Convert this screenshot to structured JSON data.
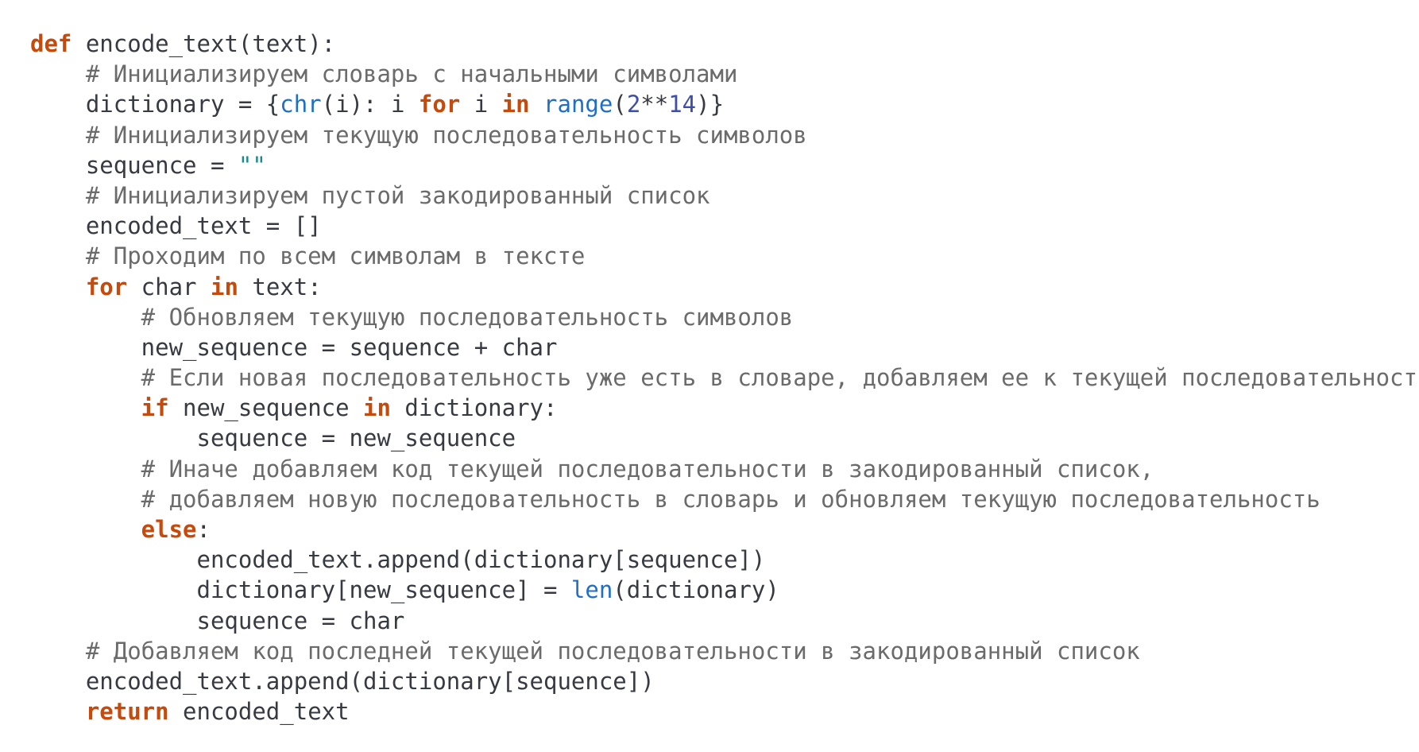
{
  "code": {
    "language": "python",
    "colors": {
      "keyword": "#c54a0b",
      "comment": "#6b6b6b",
      "builtin": "#1f6fc5",
      "number": "#3f4fa8",
      "string": "#1b8a8e",
      "text": "#383a42"
    },
    "lines": [
      {
        "indent": 0,
        "tokens": [
          {
            "t": "kw",
            "v": "def"
          },
          {
            "t": "plain",
            "v": " encode_text(text):"
          }
        ]
      },
      {
        "indent": 1,
        "tokens": [
          {
            "t": "cm",
            "v": "# Инициализируем словарь с начальными символами"
          }
        ]
      },
      {
        "indent": 1,
        "tokens": [
          {
            "t": "plain",
            "v": "dictionary = {"
          },
          {
            "t": "bi",
            "v": "chr"
          },
          {
            "t": "plain",
            "v": "(i): i "
          },
          {
            "t": "kw",
            "v": "for"
          },
          {
            "t": "plain",
            "v": " i "
          },
          {
            "t": "kw",
            "v": "in"
          },
          {
            "t": "plain",
            "v": " "
          },
          {
            "t": "bi",
            "v": "range"
          },
          {
            "t": "plain",
            "v": "("
          },
          {
            "t": "num",
            "v": "2"
          },
          {
            "t": "plain",
            "v": "**"
          },
          {
            "t": "num",
            "v": "14"
          },
          {
            "t": "plain",
            "v": ")}"
          }
        ]
      },
      {
        "indent": 1,
        "tokens": [
          {
            "t": "cm",
            "v": "# Инициализируем текущую последовательность символов"
          }
        ]
      },
      {
        "indent": 1,
        "tokens": [
          {
            "t": "plain",
            "v": "sequence = "
          },
          {
            "t": "str",
            "v": "\"\""
          }
        ]
      },
      {
        "indent": 1,
        "tokens": [
          {
            "t": "cm",
            "v": "# Инициализируем пустой закодированный список"
          }
        ]
      },
      {
        "indent": 1,
        "tokens": [
          {
            "t": "plain",
            "v": "encoded_text = []"
          }
        ]
      },
      {
        "indent": 1,
        "tokens": [
          {
            "t": "cm",
            "v": "# Проходим по всем символам в тексте"
          }
        ]
      },
      {
        "indent": 1,
        "tokens": [
          {
            "t": "kw",
            "v": "for"
          },
          {
            "t": "plain",
            "v": " char "
          },
          {
            "t": "kw",
            "v": "in"
          },
          {
            "t": "plain",
            "v": " text:"
          }
        ]
      },
      {
        "indent": 2,
        "tokens": [
          {
            "t": "cm",
            "v": "# Обновляем текущую последовательность символов"
          }
        ]
      },
      {
        "indent": 2,
        "tokens": [
          {
            "t": "plain",
            "v": "new_sequence = sequence + char"
          }
        ]
      },
      {
        "indent": 2,
        "tokens": [
          {
            "t": "cm",
            "v": "# Если новая последовательность уже есть в словаре, добавляем ее к текущей последовательности"
          }
        ]
      },
      {
        "indent": 2,
        "tokens": [
          {
            "t": "kw",
            "v": "if"
          },
          {
            "t": "plain",
            "v": " new_sequence "
          },
          {
            "t": "kw",
            "v": "in"
          },
          {
            "t": "plain",
            "v": " dictionary:"
          }
        ]
      },
      {
        "indent": 3,
        "tokens": [
          {
            "t": "plain",
            "v": "sequence = new_sequence"
          }
        ]
      },
      {
        "indent": 2,
        "tokens": [
          {
            "t": "cm",
            "v": "# Иначе добавляем код текущей последовательности в закодированный список,"
          }
        ]
      },
      {
        "indent": 2,
        "tokens": [
          {
            "t": "cm",
            "v": "# добавляем новую последовательность в словарь и обновляем текущую последовательность"
          }
        ]
      },
      {
        "indent": 2,
        "tokens": [
          {
            "t": "kw",
            "v": "else"
          },
          {
            "t": "plain",
            "v": ":"
          }
        ]
      },
      {
        "indent": 3,
        "tokens": [
          {
            "t": "plain",
            "v": "encoded_text.append(dictionary[sequence])"
          }
        ]
      },
      {
        "indent": 3,
        "tokens": [
          {
            "t": "plain",
            "v": "dictionary[new_sequence] = "
          },
          {
            "t": "bi",
            "v": "len"
          },
          {
            "t": "plain",
            "v": "(dictionary)"
          }
        ]
      },
      {
        "indent": 3,
        "tokens": [
          {
            "t": "plain",
            "v": "sequence = char"
          }
        ]
      },
      {
        "indent": 1,
        "tokens": [
          {
            "t": "cm",
            "v": "# Добавляем код последней текущей последовательности в закодированный список"
          }
        ]
      },
      {
        "indent": 1,
        "tokens": [
          {
            "t": "plain",
            "v": "encoded_text.append(dictionary[sequence])"
          }
        ]
      },
      {
        "indent": 1,
        "tokens": [
          {
            "t": "kw",
            "v": "return"
          },
          {
            "t": "plain",
            "v": " encoded_text"
          }
        ]
      }
    ]
  }
}
